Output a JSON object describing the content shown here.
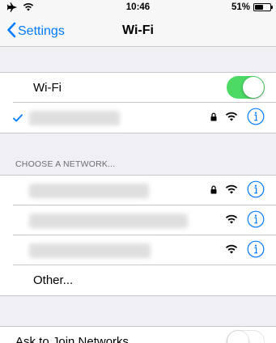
{
  "status_bar": {
    "time": "10:46",
    "battery_text": "51%",
    "battery_level": 0.51,
    "icons": [
      "airplane-icon",
      "wifi-icon",
      "battery-icon"
    ]
  },
  "nav": {
    "back_label": "Settings",
    "title": "Wi-Fi"
  },
  "wifi_toggle": {
    "label": "Wi-Fi",
    "on": true,
    "on_color": "#4cd964"
  },
  "connected_network": {
    "name_hidden": true,
    "secured": true
  },
  "section_header": "CHOOSE A NETWORK...",
  "networks": [
    {
      "name_hidden": true,
      "secured": true
    },
    {
      "name_hidden": true,
      "secured": false
    },
    {
      "name_hidden": true,
      "secured": false
    }
  ],
  "other_label": "Other...",
  "ask_to_join": {
    "label": "Ask to Join Networks",
    "on": false
  },
  "colors": {
    "accent": "#007aff",
    "background": "#efeff4",
    "separator": "#c8c7cc"
  }
}
